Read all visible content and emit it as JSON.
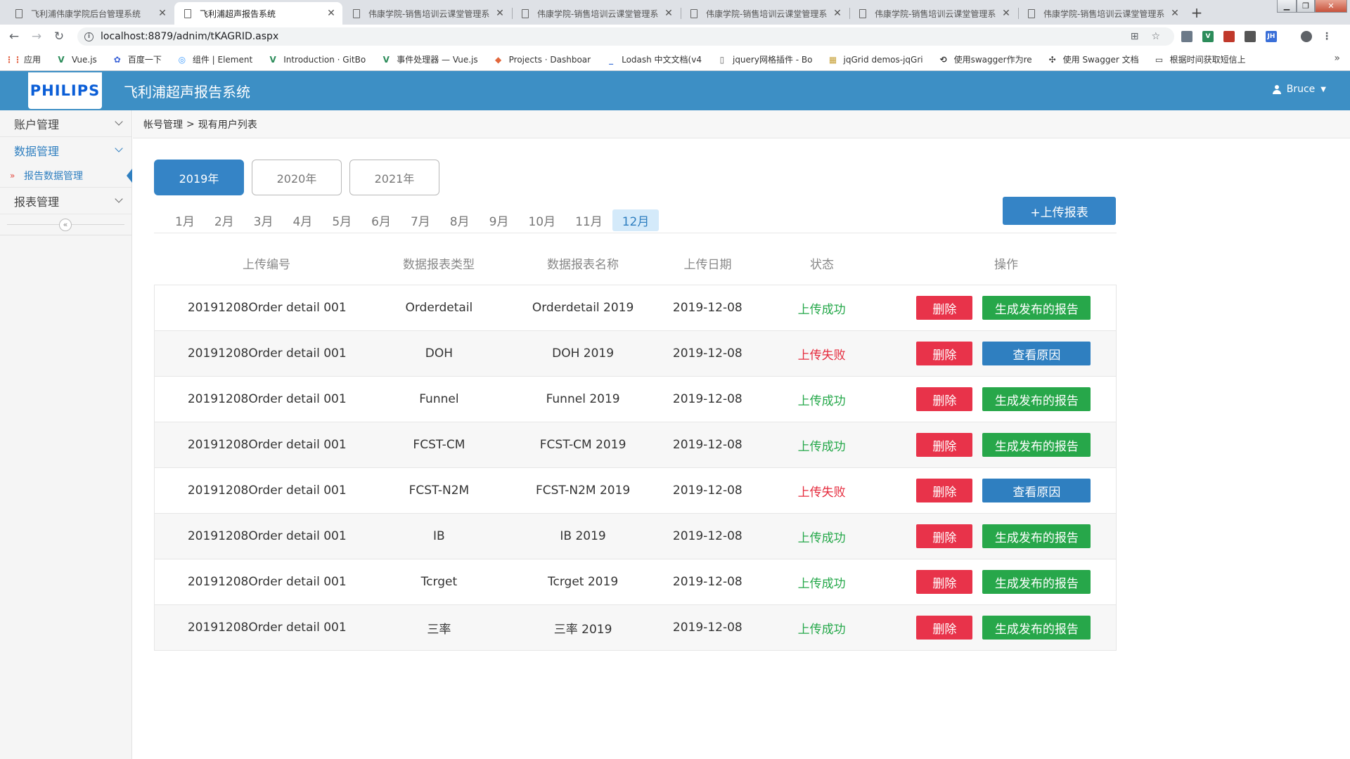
{
  "browser": {
    "tabs": [
      {
        "title": "飞利浦伟康学院后台管理系统",
        "active": false
      },
      {
        "title": "飞利浦超声报告系统",
        "active": true
      },
      {
        "title": "伟康学院-销售培训云课堂管理系",
        "active": false
      },
      {
        "title": "伟康学院-销售培训云课堂管理系",
        "active": false
      },
      {
        "title": "伟康学院-销售培训云课堂管理系",
        "active": false
      },
      {
        "title": "伟康学院-销售培训云课堂管理系",
        "active": false
      },
      {
        "title": "伟康学院-销售培训云课堂管理系",
        "active": false
      }
    ],
    "url": "localhost:8879/adnim/tKAGRID.aspx",
    "bookmarks": [
      {
        "label": "应用",
        "icon": "apps-grid-icon",
        "color": "#e25a3a"
      },
      {
        "label": "Vue.js",
        "icon": "vue-icon",
        "color": "#2c8c5a"
      },
      {
        "label": "百度一下",
        "icon": "baidu-icon",
        "color": "#3a62d8"
      },
      {
        "label": "组件 | Element",
        "icon": "element-icon",
        "color": "#409eff"
      },
      {
        "label": "Introduction · GitBo",
        "icon": "vue-icon",
        "color": "#2c8c5a"
      },
      {
        "label": "事件处理器 — Vue.js",
        "icon": "vue-icon",
        "color": "#2c8c5a"
      },
      {
        "label": "Projects · Dashboar",
        "icon": "gitlab-icon",
        "color": "#e2673c"
      },
      {
        "label": "Lodash 中文文档(v4",
        "icon": "lodash-icon",
        "color": "#3a6fd8"
      },
      {
        "label": "jquery网格插件 - Bo",
        "icon": "page-icon",
        "color": "#666666"
      },
      {
        "label": "jqGrid demos-jqGri",
        "icon": "jqgrid-icon",
        "color": "#c8a23a"
      },
      {
        "label": "使用swagger作为re",
        "icon": "swagger-icon",
        "color": "#333333"
      },
      {
        "label": "使用 Swagger 文档",
        "icon": "swagger2-icon",
        "color": "#333333"
      },
      {
        "label": "根据时间获取短信上",
        "icon": "book-icon",
        "color": "#333333"
      }
    ]
  },
  "app": {
    "logo_text": "PHILIPS",
    "title": "飞利浦超声报告系统",
    "user": "Bruce",
    "colors": {
      "header": "#3d8fc5",
      "primary": "#3584c6",
      "danger": "#e8334a",
      "success": "#27a74a",
      "status_ok": "#25a84a",
      "status_fail": "#e52a3c"
    }
  },
  "sidebar": {
    "items": [
      {
        "label": "账户管理",
        "open": false
      },
      {
        "label": "数据管理",
        "open": true,
        "children": [
          "报告数据管理"
        ]
      },
      {
        "label": "报表管理",
        "open": false
      }
    ],
    "collapse_symbol": "«"
  },
  "breadcrumb": {
    "parent": "帐号管理",
    "separator": ">",
    "current": "现有用户列表"
  },
  "years": [
    "2019年",
    "2020年",
    "2021年"
  ],
  "active_year": "2019年",
  "months": [
    "1月",
    "2月",
    "3月",
    "4月",
    "5月",
    "6月",
    "7月",
    "8月",
    "9月",
    "10月",
    "11月",
    "12月"
  ],
  "active_month": "12月",
  "upload_label": "+上传报表",
  "table": {
    "headers": [
      "上传编号",
      "数据报表类型",
      "数据报表名称",
      "上传日期",
      "状态",
      "操作"
    ],
    "rows": [
      {
        "id": "20191208Order detail 001",
        "type": "Orderdetail",
        "name": "Orderdetail 2019",
        "date": "2019-12-08",
        "status": "上传成功",
        "ok": true,
        "action": "生成发布的报告"
      },
      {
        "id": "20191208Order detail 001",
        "type": "DOH",
        "name": "DOH 2019",
        "date": "2019-12-08",
        "status": "上传失败",
        "ok": false,
        "action": "查看原因"
      },
      {
        "id": "20191208Order detail 001",
        "type": "Funnel",
        "name": "Funnel 2019",
        "date": "2019-12-08",
        "status": "上传成功",
        "ok": true,
        "action": "生成发布的报告"
      },
      {
        "id": "20191208Order detail 001",
        "type": "FCST-CM",
        "name": "FCST-CM 2019",
        "date": "2019-12-08",
        "status": "上传成功",
        "ok": true,
        "action": "生成发布的报告"
      },
      {
        "id": "20191208Order detail 001",
        "type": "FCST-N2M",
        "name": "FCST-N2M 2019",
        "date": "2019-12-08",
        "status": "上传失败",
        "ok": false,
        "action": "查看原因"
      },
      {
        "id": "20191208Order detail 001",
        "type": "IB",
        "name": "IB 2019",
        "date": "2019-12-08",
        "status": "上传成功",
        "ok": true,
        "action": "生成发布的报告"
      },
      {
        "id": "20191208Order detail 001",
        "type": "Tcrget",
        "name": "Tcrget 2019",
        "date": "2019-12-08",
        "status": "上传成功",
        "ok": true,
        "action": "生成发布的报告"
      },
      {
        "id": "20191208Order detail 001",
        "type": "三率",
        "name": "三率 2019",
        "date": "2019-12-08",
        "status": "上传成功",
        "ok": true,
        "action": "生成发布的报告"
      }
    ],
    "delete_label": "删除"
  }
}
